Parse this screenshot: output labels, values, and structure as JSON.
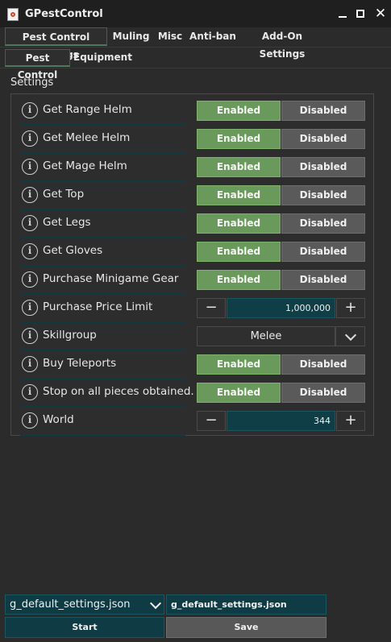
{
  "window": {
    "title": "GPestControl"
  },
  "tabs": [
    {
      "label": "Pest Control Settings"
    },
    {
      "label": "Muling"
    },
    {
      "label": "Misc"
    },
    {
      "label": "Anti-ban"
    },
    {
      "label": "Add-On Settings"
    }
  ],
  "subtabs": [
    {
      "label": "Pest Control"
    },
    {
      "label": "Equipment"
    }
  ],
  "section": {
    "title": "Settings"
  },
  "rows": [
    {
      "label": "Get Range Helm",
      "on": "Enabled",
      "off": "Disabled"
    },
    {
      "label": "Get Melee Helm",
      "on": "Enabled",
      "off": "Disabled"
    },
    {
      "label": "Get Mage Helm",
      "on": "Enabled",
      "off": "Disabled"
    },
    {
      "label": "Get Top",
      "on": "Enabled",
      "off": "Disabled"
    },
    {
      "label": "Get Legs",
      "on": "Enabled",
      "off": "Disabled"
    },
    {
      "label": "Get Gloves",
      "on": "Enabled",
      "off": "Disabled"
    },
    {
      "label": "Purchase Minigame Gear",
      "on": "Enabled",
      "off": "Disabled"
    },
    {
      "label": "Purchase Price Limit",
      "value": "1,000,000"
    },
    {
      "label": "Skillgroup",
      "value": "Melee"
    },
    {
      "label": "Buy Teleports",
      "on": "Enabled",
      "off": "Disabled"
    },
    {
      "label": "Stop on all pieces obtained.",
      "on": "Enabled",
      "off": "Disabled"
    },
    {
      "label": "World",
      "value": "344"
    }
  ],
  "footer": {
    "profile_select": "g_default_settings.json",
    "filename": "g_default_settings.json",
    "start_label": "Start",
    "save_label": "Save"
  },
  "colors": {
    "enabled": "#6a9a5b",
    "disabled": "#5a5a5a",
    "accent": "#0f3e47",
    "background": "#2b2b2b"
  }
}
